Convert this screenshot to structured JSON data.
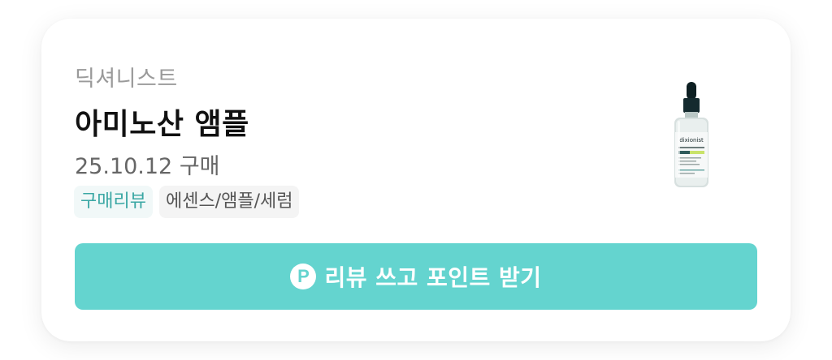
{
  "product": {
    "brand": "딕셔니스트",
    "name": "아미노산 앰플",
    "purchase_date": "25.10.12 구매",
    "thumbnail_label": "dixionist"
  },
  "tags": [
    "구매리뷰",
    "에센스/앰플/세럼"
  ],
  "cta": {
    "icon": "P",
    "label": "리뷰 쓰고 포인트 받기"
  },
  "colors": {
    "accent": "#64d4cf",
    "tag_review_text": "#3aa7a4",
    "tag_review_bg": "#f1f8f8",
    "tag_category_bg": "#f4f4f4"
  }
}
